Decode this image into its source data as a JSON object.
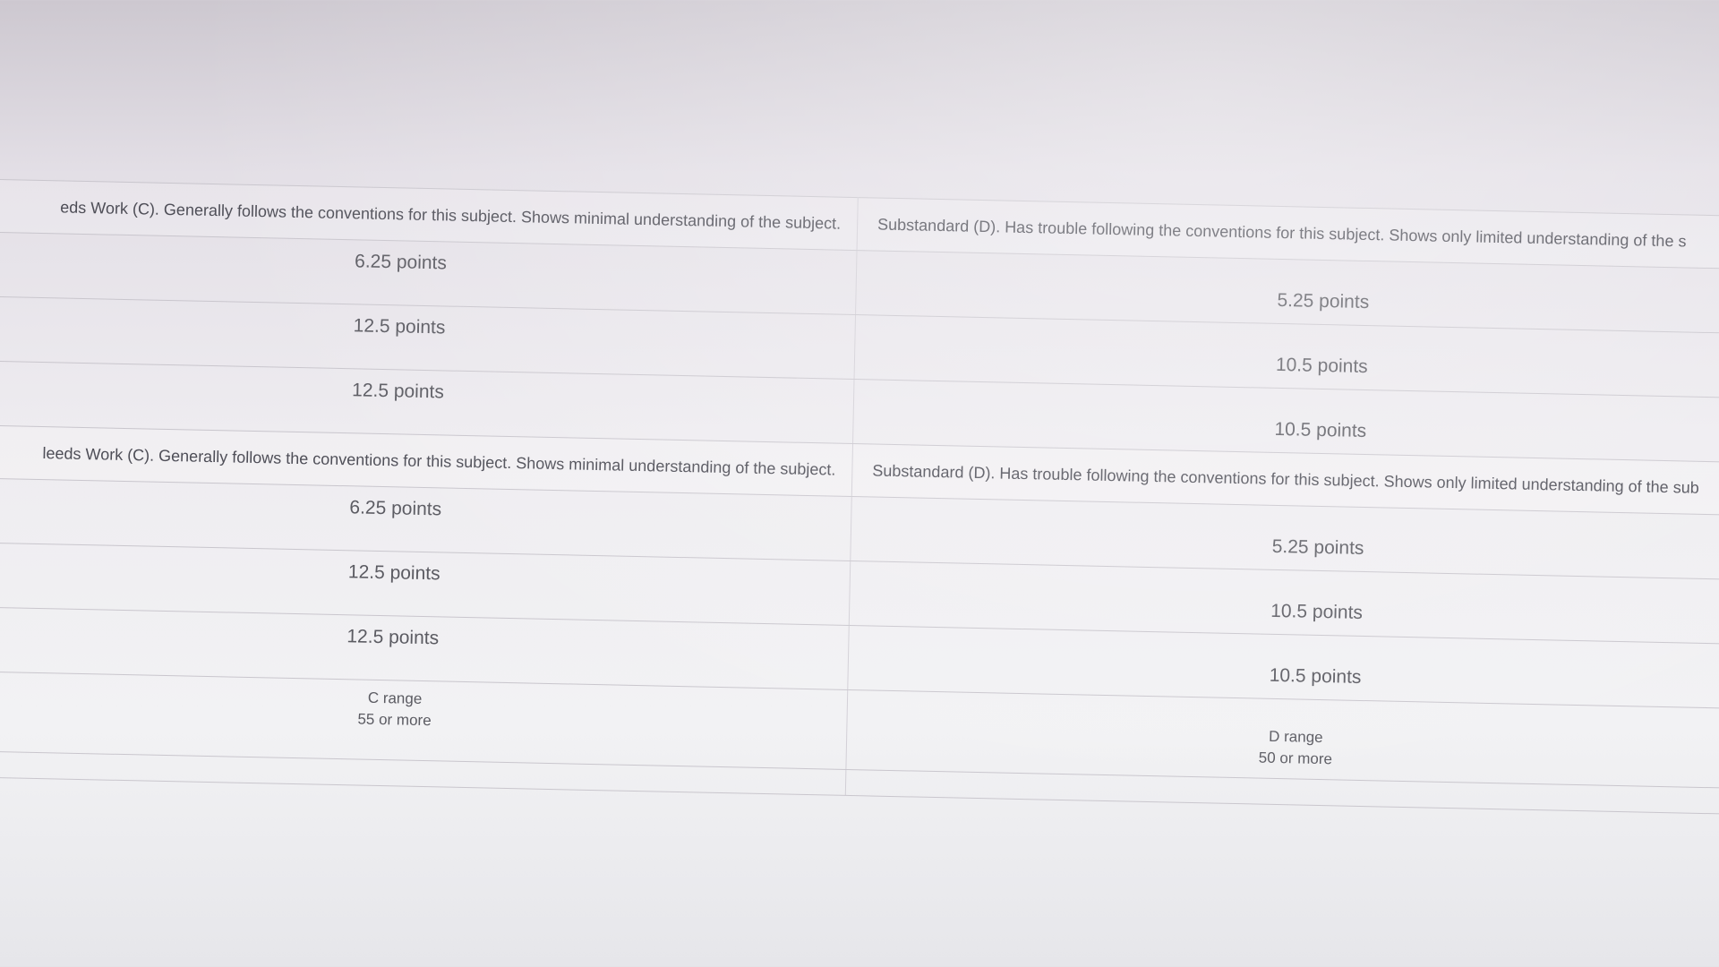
{
  "rubric": {
    "sections": [
      {
        "header_c": "eds Work (C). Generally follows the conventions for this subject. Shows minimal understanding of the subject.",
        "header_d": "Substandard (D). Has trouble following the conventions for this subject. Shows only limited understanding of the s",
        "rows": [
          {
            "c": "6.25 points",
            "d": "5.25 points"
          },
          {
            "c": "12.5 points",
            "d": "10.5 points"
          },
          {
            "c": "12.5 points",
            "d": "10.5 points"
          }
        ]
      },
      {
        "header_c": "leeds Work (C). Generally follows the conventions for this subject. Shows minimal understanding of the subject.",
        "header_d": "Substandard (D). Has trouble following the conventions for this subject. Shows only limited understanding of the sub",
        "rows": [
          {
            "c": "6.25 points",
            "d": "5.25 points"
          },
          {
            "c": "12.5 points",
            "d": "10.5 points"
          },
          {
            "c": "12.5 points",
            "d": "10.5 points"
          }
        ]
      }
    ],
    "range_c": {
      "label": "C range",
      "value": "55 or more"
    },
    "range_d": {
      "label": "D range",
      "value": "50 or more"
    }
  }
}
